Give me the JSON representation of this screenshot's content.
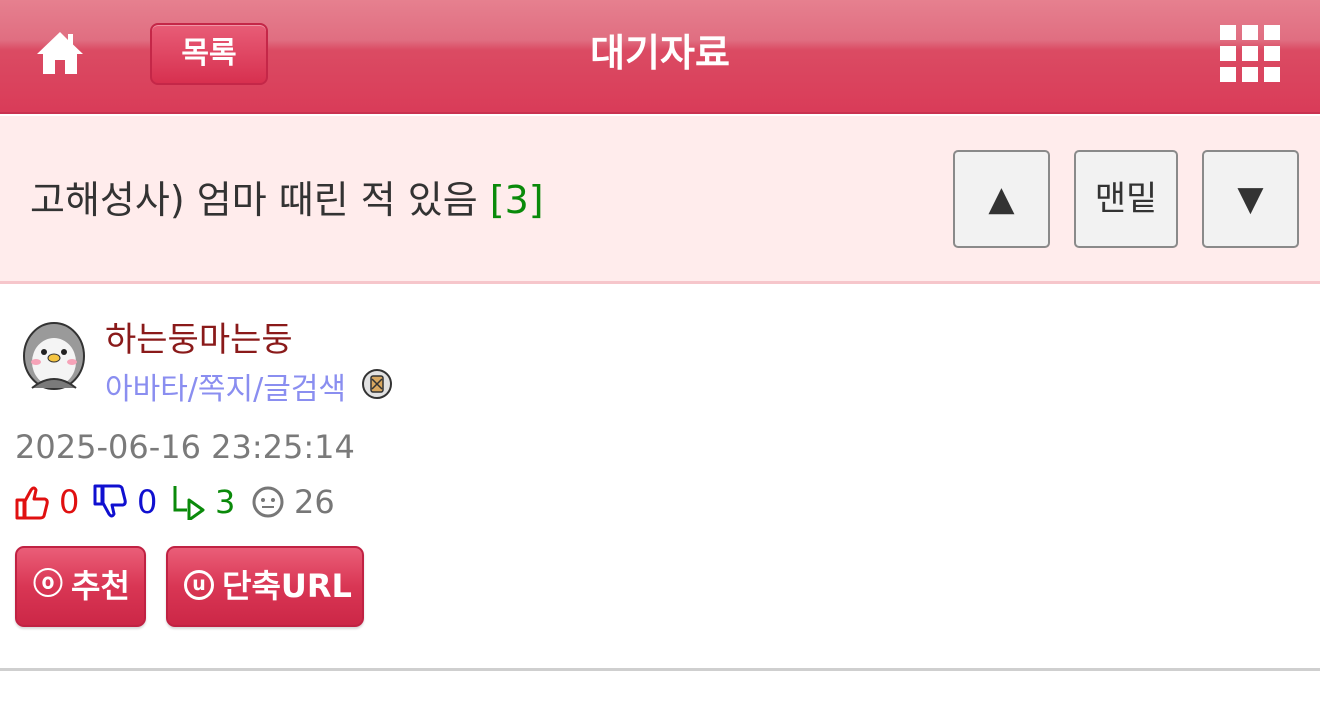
{
  "header": {
    "list_label": "목록",
    "title": "대기자료",
    "home_icon": "home-icon",
    "menu_icon": "grid-menu-icon"
  },
  "post": {
    "title": "고해성사) 엄마 때린 적 있음",
    "reply_count": "[3]",
    "nav": {
      "up_symbol": "▲",
      "bottom_label": "맨밑",
      "down_symbol": "▼"
    }
  },
  "author": {
    "name": "하는둥마는둥",
    "links": "아바타/쪽지/글검색",
    "avatar_icon": "penguin-avatar-icon",
    "badge_icon": "level-badge-icon"
  },
  "meta": {
    "date": "2025-06-16 23:25:14",
    "upvotes": "0",
    "downvotes": "0",
    "replies": "3",
    "views": "26"
  },
  "actions": {
    "recommend_symbol": "ⓞ",
    "recommend_label": "추천",
    "shorturl_symbol": "u",
    "shorturl_label": "단축URL"
  },
  "colors": {
    "header_red": "#d93b58",
    "title_bg": "#ffecec",
    "upvote": "#e01010",
    "downvote": "#1010d0",
    "reply": "#0a8a0a",
    "views": "#777777"
  }
}
